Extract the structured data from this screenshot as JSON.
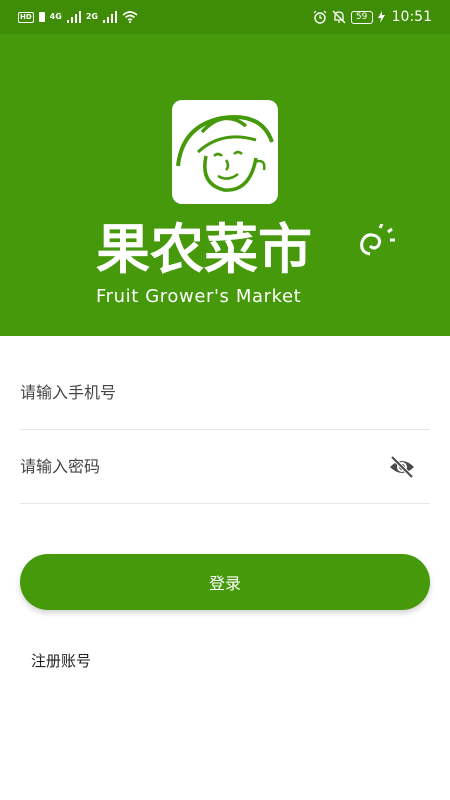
{
  "status_bar": {
    "hd": "HD",
    "sim1": "4G",
    "sim2": "2G",
    "battery": "59",
    "time": "10:51",
    "icons": [
      "signal-icon",
      "wifi-icon",
      "alarm-icon",
      "mute-icon",
      "battery-icon",
      "charging-icon"
    ]
  },
  "brand": {
    "name_cn": "果农菜市",
    "name_en": "Fruit Grower's Market",
    "logo": "farmer-face-logo"
  },
  "form": {
    "phone_placeholder": "请输入手机号",
    "phone_value": "",
    "password_placeholder": "请输入密码",
    "password_value": "",
    "login_label": "登录",
    "register_label": "注册账号"
  },
  "colors": {
    "brand_green": "#46990a",
    "status_green": "#3f8c06",
    "background": "#ffffff"
  }
}
